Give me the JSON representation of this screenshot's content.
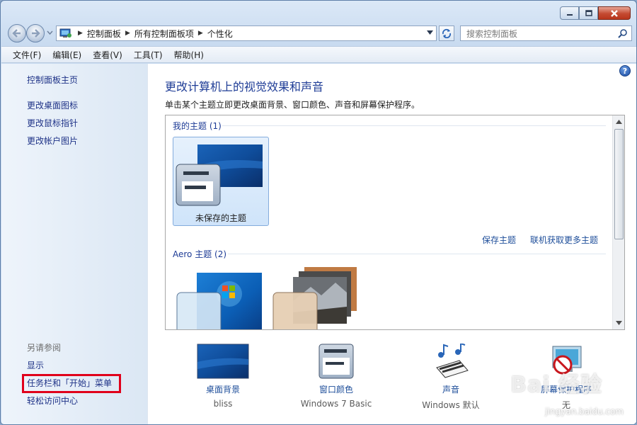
{
  "window": {
    "controls": {
      "minimize": "minimize-icon",
      "maximize": "maximize-icon",
      "close": "close-icon"
    }
  },
  "address": {
    "breadcrumbs": [
      "控制面板",
      "所有控制面板项",
      "个性化"
    ],
    "search_placeholder": "搜索控制面板"
  },
  "menu": [
    "文件(F)",
    "编辑(E)",
    "查看(V)",
    "工具(T)",
    "帮助(H)"
  ],
  "sidebar": {
    "home": "控制面板主页",
    "links": [
      "更改桌面图标",
      "更改鼠标指针",
      "更改帐户图片"
    ],
    "see_also_title": "另请参阅",
    "see_also": [
      "显示",
      "任务栏和「开始」菜单",
      "轻松访问中心"
    ]
  },
  "main": {
    "title": "更改计算机上的视觉效果和声音",
    "subtitle": "单击某个主题立即更改桌面背景、窗口颜色、声音和屏幕保护程序。",
    "groups": {
      "my_themes": "我的主题 (1)",
      "aero_themes": "Aero 主题 (2)"
    },
    "unsaved_theme": "未保存的主题",
    "save_theme": "保存主题",
    "get_more": "联机获取更多主题"
  },
  "bottom": [
    {
      "label": "桌面背景",
      "value": "bliss",
      "icon": "desktop-background-icon"
    },
    {
      "label": "窗口颜色",
      "value": "Windows 7 Basic",
      "icon": "window-color-icon"
    },
    {
      "label": "声音",
      "value": "Windows 默认",
      "icon": "sound-icon"
    },
    {
      "label": "屏幕保护程序",
      "value": "无",
      "icon": "screensaver-icon"
    }
  ],
  "watermark": {
    "brand": "Bai 经验",
    "url": "jingyan.baidu.com"
  },
  "colors": {
    "link": "#1e3287",
    "title": "#1e3c96",
    "highlight": "#e0001b"
  }
}
